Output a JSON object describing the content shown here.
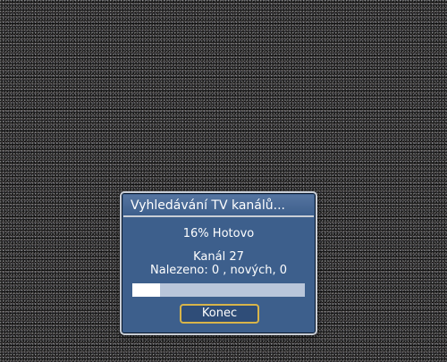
{
  "dialog": {
    "title": "Vyhledávání TV kanálů...",
    "status": "16% Hotovo",
    "channel": "Kanál 27",
    "found": "Nalezeno: 0 , nových, 0",
    "progress_fraction": 0.16,
    "button_label": "Konec"
  },
  "colors": {
    "dialog_bg": "#3d5f8c",
    "border": "#c9ced6",
    "button_border": "#d8b44a",
    "progress_track": "#b9c6da",
    "progress_fill": "#ffffff"
  }
}
